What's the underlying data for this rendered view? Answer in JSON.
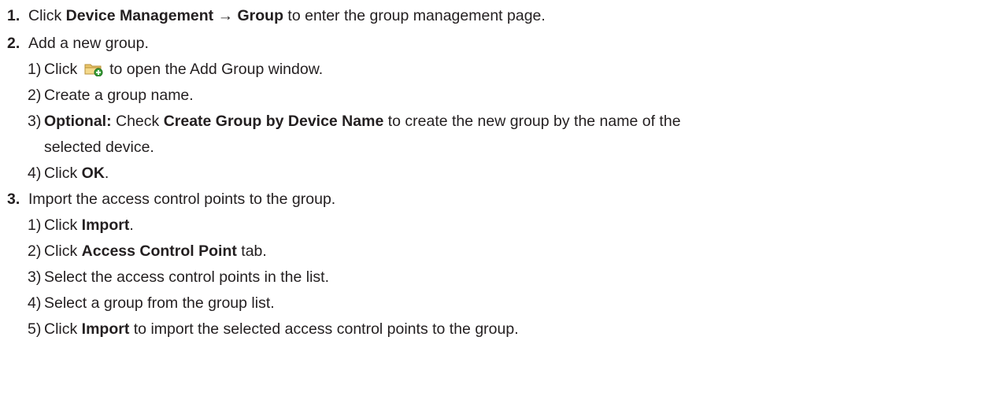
{
  "steps": [
    {
      "num": "1.",
      "pre": "Click ",
      "bold": "Device Management → Group",
      "post": " to enter the group management page."
    },
    {
      "num": "2.",
      "text": "Add a new group.",
      "substeps": [
        {
          "num": "1)",
          "pre": "Click ",
          "icon": "add-group-folder-icon",
          "post": " to open the Add Group window."
        },
        {
          "num": "2)",
          "text": "Create a group name."
        },
        {
          "num": "3)",
          "bold1": "Optional:",
          "mid": " Check ",
          "bold2": "Create Group by Device Name",
          "post": " to create the new group by the name of the",
          "cont": "selected device."
        },
        {
          "num": "4)",
          "pre": "Click ",
          "bold": "OK",
          "post": "."
        }
      ]
    },
    {
      "num": "3.",
      "text": "Import the access control points to the group.",
      "substeps": [
        {
          "num": "1)",
          "pre": "Click ",
          "bold": "Import",
          "post": "."
        },
        {
          "num": "2)",
          "pre": "Click ",
          "bold": "Access Control Point",
          "post": " tab."
        },
        {
          "num": "3)",
          "text": "Select the access control points in the list."
        },
        {
          "num": "4)",
          "text": "Select a group from the group list."
        },
        {
          "num": "5)",
          "pre": "Click ",
          "bold": "Import",
          "post": " to import the selected access control points to the group."
        }
      ]
    }
  ]
}
